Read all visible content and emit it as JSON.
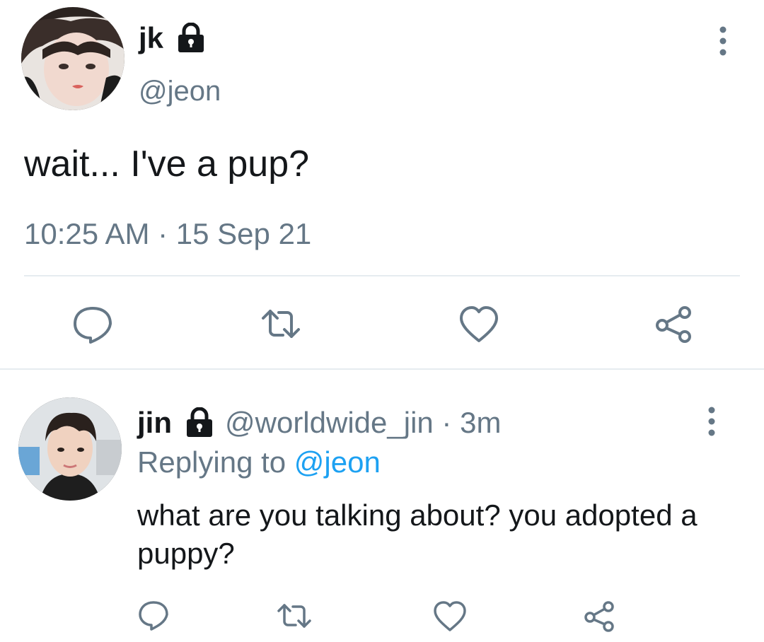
{
  "main_tweet": {
    "name": "jk",
    "handle": "@jeon",
    "text": "wait... I've a pup?",
    "timestamp": "10:25 AM · 15 Sep 21",
    "icons": {
      "lock": "lock-icon",
      "more": "more-vertical-icon",
      "reply": "reply-icon",
      "retweet": "retweet-icon",
      "like": "heart-icon",
      "share": "share-icon"
    }
  },
  "reply_tweet": {
    "name": "jin",
    "handle_time": "@worldwide_jin · 3m",
    "replying_prefix": "Replying to ",
    "replying_mention": "@jeon",
    "text": "what are you talking about? you adopted a puppy?"
  },
  "colors": {
    "text": "#14171a",
    "secondary": "#657786",
    "link": "#1da1f2",
    "divider": "#e6ecf0",
    "icon": "#657786"
  }
}
